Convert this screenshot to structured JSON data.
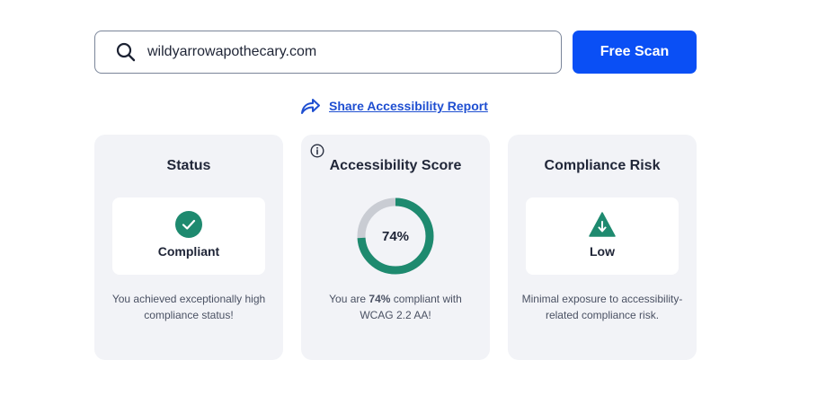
{
  "search": {
    "value": "wildyarrowapothecary.com",
    "button_label": "Free Scan"
  },
  "share": {
    "label": "Share Accessibility Report"
  },
  "status_card": {
    "title": "Status",
    "value": "Compliant",
    "description": "You achieved exceptionally high compliance status!"
  },
  "score_card": {
    "title": "Accessibility Score",
    "score_percent": 74,
    "score_label": "74%",
    "desc_prefix": "You are ",
    "desc_strong": "74%",
    "desc_suffix": " compliant with WCAG 2.2 AA!"
  },
  "risk_card": {
    "title": "Compliance Risk",
    "value": "Low",
    "description": "Minimal exposure to accessibility-related compliance risk."
  },
  "colors": {
    "accent": "#0a4ff5",
    "success": "#1e8a6f",
    "track": "#c9ccd3",
    "card_bg": "#f2f3f7"
  }
}
